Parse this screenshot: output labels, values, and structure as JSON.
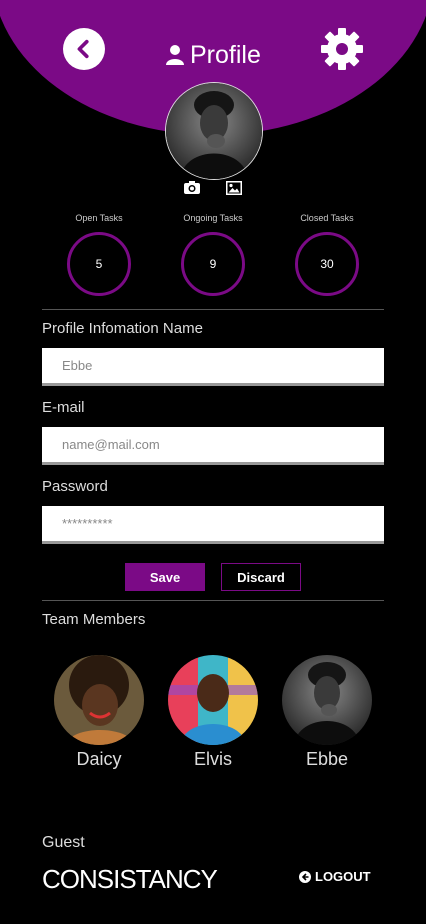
{
  "header": {
    "title": "Profile",
    "back_icon": "chevron-left-circle-icon",
    "settings_icon": "gear-icon",
    "accent": "#7b0a86"
  },
  "stats": [
    {
      "label": "Open Tasks",
      "value": "5"
    },
    {
      "label": "Ongoing Tasks",
      "value": "9"
    },
    {
      "label": "Closed Tasks",
      "value": "30"
    }
  ],
  "form": {
    "name_label": "Profile Infomation Name",
    "name_value": "Ebbe",
    "email_label": "E-mail",
    "email_placeholder": "name@mail.com",
    "password_label": "Password",
    "password_value": "**********",
    "save_label": "Save",
    "discard_label": "Discard"
  },
  "team": {
    "heading": "Team Members",
    "members": [
      {
        "name": "Daicy"
      },
      {
        "name": "Elvis"
      },
      {
        "name": "Ebbe"
      }
    ]
  },
  "footer": {
    "guest_label": "Guest",
    "brand": "CONSISTANCY",
    "logout_label": "LOGOUT"
  }
}
